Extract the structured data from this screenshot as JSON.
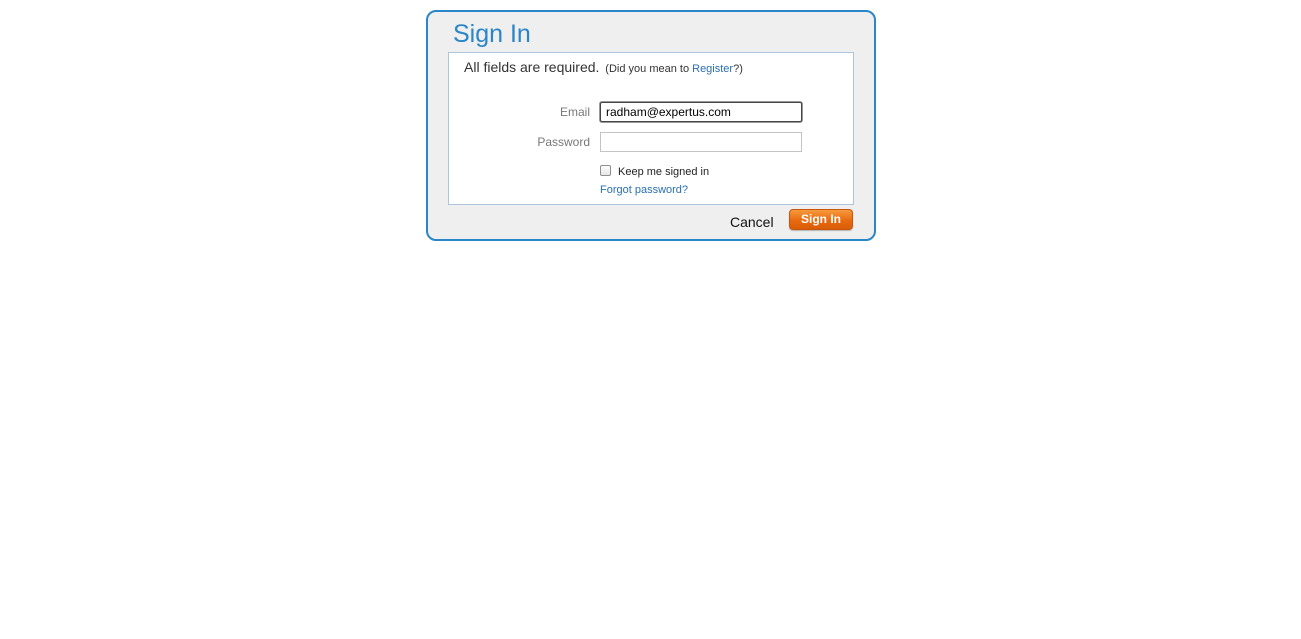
{
  "dialog": {
    "title": "Sign In"
  },
  "form": {
    "required_text": "All fields are required.",
    "hint_prefix": "(Did you mean to ",
    "register_link": "Register",
    "hint_suffix": "?)",
    "email": {
      "label": "Email",
      "value": "radham@expertus.com"
    },
    "password": {
      "label": "Password",
      "value": ""
    },
    "keep_signed_in": {
      "label": "Keep me signed in",
      "checked": false
    },
    "forgot_password_link": "Forgot password?"
  },
  "actions": {
    "cancel_label": "Cancel",
    "signin_label": "Sign In"
  },
  "colors": {
    "accent": "#2a86c8",
    "signin_button": "#e86a0f",
    "link": "#2a6fb0"
  }
}
